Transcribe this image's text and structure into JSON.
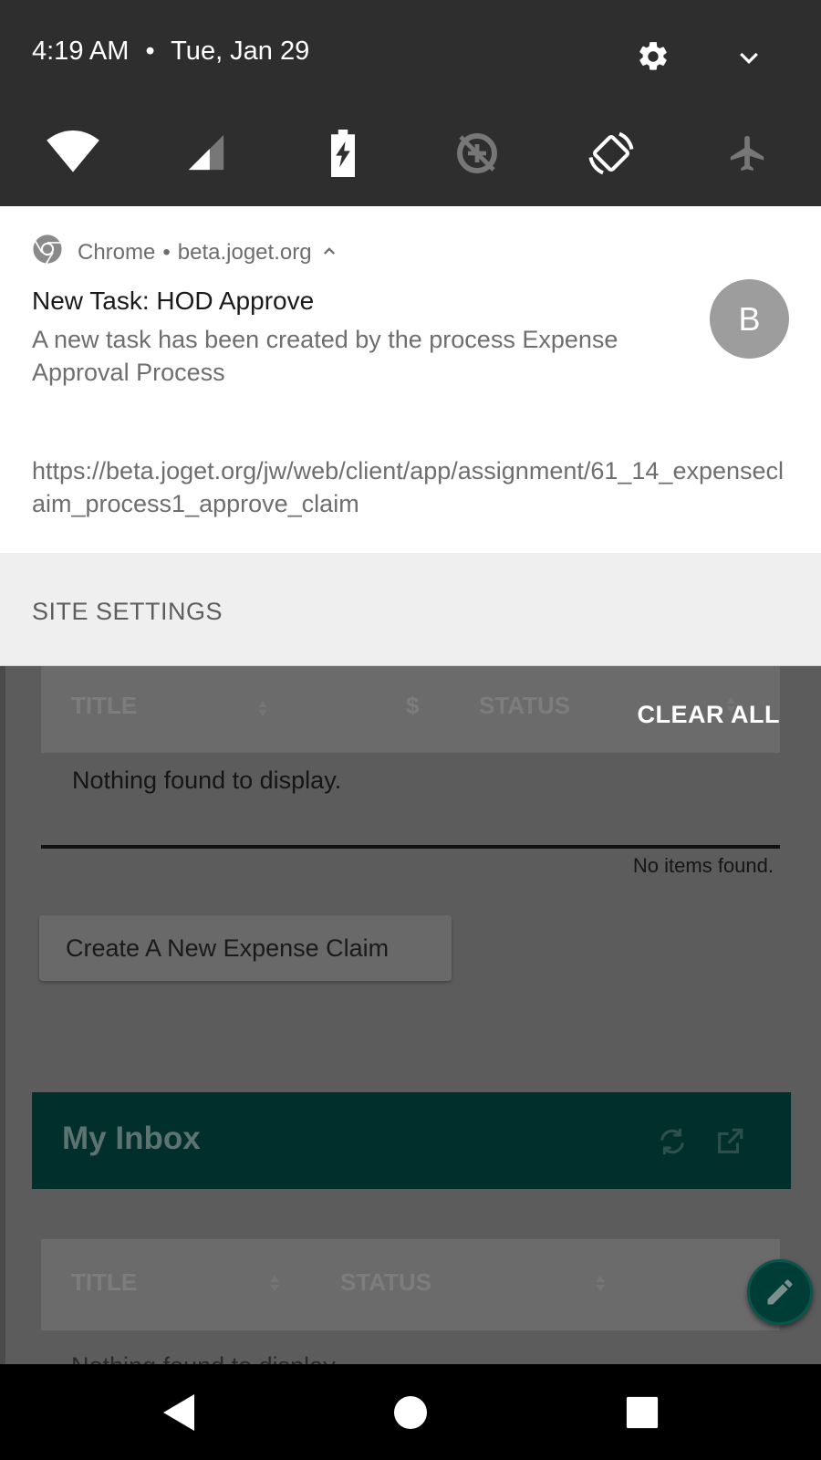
{
  "status_bar": {
    "time": "4:19 AM",
    "separator": "•",
    "date": "Tue, Jan 29"
  },
  "quick_settings": {
    "tiles": [
      "wifi-icon",
      "cell-signal-icon",
      "battery-saver-icon",
      "data-saver-icon",
      "auto-rotate-icon",
      "airplane-mode-icon"
    ]
  },
  "notification": {
    "app_name": "Chrome",
    "separator": "•",
    "origin": "beta.joget.org",
    "title": "New Task: HOD Approve",
    "body": "A new task has been created by the process Expense Approval Process",
    "url": "https://beta.joget.org/jw/web/client/app/assignment/61_14_expenseclaim_process1_approve_claim",
    "avatar_letter": "B",
    "action_label": "SITE SETTINGS"
  },
  "clear_all_label": "CLEAR ALL",
  "background_app": {
    "claims_table": {
      "columns": [
        "TITLE",
        "$",
        "STATUS"
      ],
      "empty_message": "Nothing found to display.",
      "footer_text": "No items found."
    },
    "create_button_label": "Create A New Expense Claim",
    "inbox": {
      "title": "My Inbox",
      "columns": [
        "TITLE",
        "STATUS"
      ],
      "partial_row": "Nothing found to display."
    },
    "accent_color": "#012f2b"
  },
  "colors": {
    "quick_settings_bg": "#2e2e2e",
    "notification_bg": "#ffffff",
    "scrim": "#5c5c5c"
  }
}
